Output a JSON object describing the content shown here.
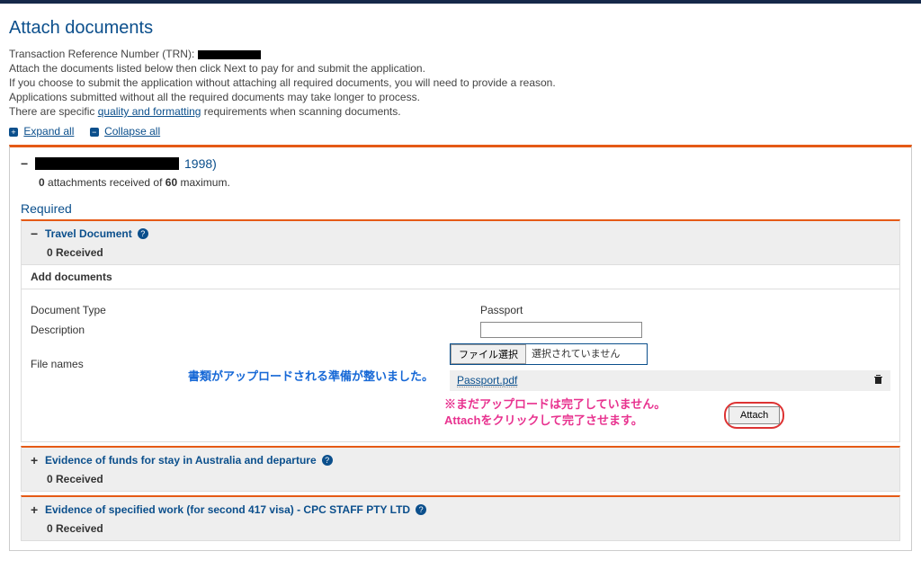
{
  "page": {
    "title": "Attach documents",
    "trn_label": "Transaction Reference Number (TRN):",
    "instr1": "Attach the documents listed below then click Next to pay for and submit the application.",
    "instr2": "If you choose to submit the application without attaching all required documents, you will need to provide a reason.",
    "instr3": "Applications submitted without all the required documents may take longer to process.",
    "instr4_prefix": "There are specific ",
    "instr4_link": "quality and formatting",
    "instr4_suffix": " requirements when scanning documents."
  },
  "expand_collapse": {
    "expand": "Expand all",
    "collapse": "Collapse all"
  },
  "applicant": {
    "year": "1998)",
    "count_prefix": "0",
    "count_mid": " attachments received of ",
    "count_max": "60",
    "count_suffix": " maximum."
  },
  "required_title": "Required",
  "doctype_section": {
    "name": "Travel Document",
    "received": "0 Received",
    "add_docs": "Add documents",
    "form": {
      "doc_type_label": "Document Type",
      "doc_type_value": "Passport",
      "desc_label": "Description",
      "desc_value": "",
      "filenames_label": "File names",
      "choose_btn": "ファイル選択",
      "no_file": "選択されていません",
      "selected_file": "Passport.pdf",
      "attach_btn": "Attach"
    }
  },
  "annotations": {
    "ready": "書類がアップロードされる準備が整いました。",
    "warn1": "※まだアップロードは完了していません。",
    "warn2": "Attachをクリックして完了させます。"
  },
  "sections": [
    {
      "name": "Evidence of funds for stay in Australia and departure",
      "received": "0 Received"
    },
    {
      "name": "Evidence of specified work (for second 417 visa) - CPC STAFF PTY LTD",
      "received": "0 Received"
    }
  ]
}
